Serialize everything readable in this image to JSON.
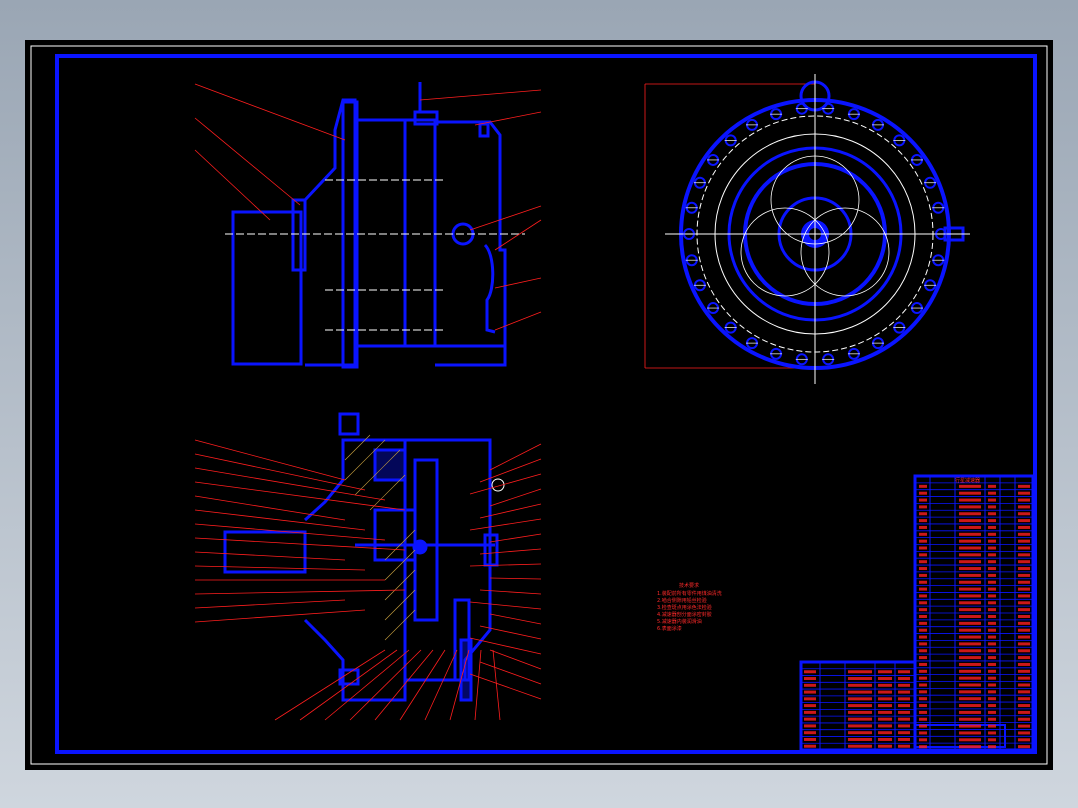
{
  "drawing": {
    "title": "",
    "colors": {
      "sheet": "#000000",
      "outline": "#0a14ff",
      "dimension": "#ff1e1e",
      "centerline": "#ffffff",
      "frame_outer": "#ffffff"
    },
    "views": [
      {
        "name": "side-elevation"
      },
      {
        "name": "end-view-circular"
      },
      {
        "name": "section-view"
      }
    ],
    "notes_title": "技术要求",
    "notes_lines": [
      "1.装配前所有零件用煤油清洗",
      "2.啮合侧隙用铅丝检验",
      "3.检查斑点用涂色法检验",
      "4.减速器剖分面涂密封胶",
      "5.减速器内装润滑油",
      "6.表面涂漆"
    ],
    "title_block": {
      "heading": "行星减速器",
      "rows": 40
    }
  }
}
